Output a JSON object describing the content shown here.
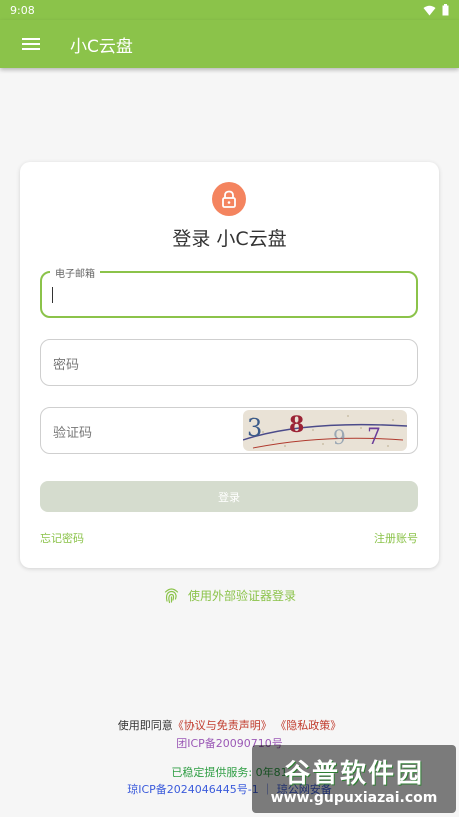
{
  "status_bar": {
    "time": "9:08"
  },
  "app_bar": {
    "title": "小C云盘"
  },
  "login": {
    "title": "登录 小C云盘",
    "email": {
      "label": "电子邮箱",
      "value": ""
    },
    "password": {
      "placeholder": "密码"
    },
    "captcha": {
      "placeholder": "验证码",
      "chars": [
        "3",
        "8",
        "9",
        "7"
      ]
    },
    "submit_label": "登录",
    "forgot_label": "忘记密码",
    "register_label": "注册账号"
  },
  "external_login_label": "使用外部验证器登录",
  "footer": {
    "agree_prefix": "使用即同意",
    "terms_link": "《协议与免责声明》",
    "privacy_link": "《隐私政策》",
    "icp_group": "团ICP备20090710号",
    "uptime": "已稳定提供服务: 0年81",
    "icp_line": "琼ICP备2024046445号-1 ｜ 琼公网安备"
  },
  "watermark": {
    "name": "谷普软件园",
    "url": "www.gupuxiazai.com"
  },
  "colors": {
    "accent": "#8bc34a",
    "lock": "#f4845f",
    "button_disabled": "#d5dcce"
  }
}
